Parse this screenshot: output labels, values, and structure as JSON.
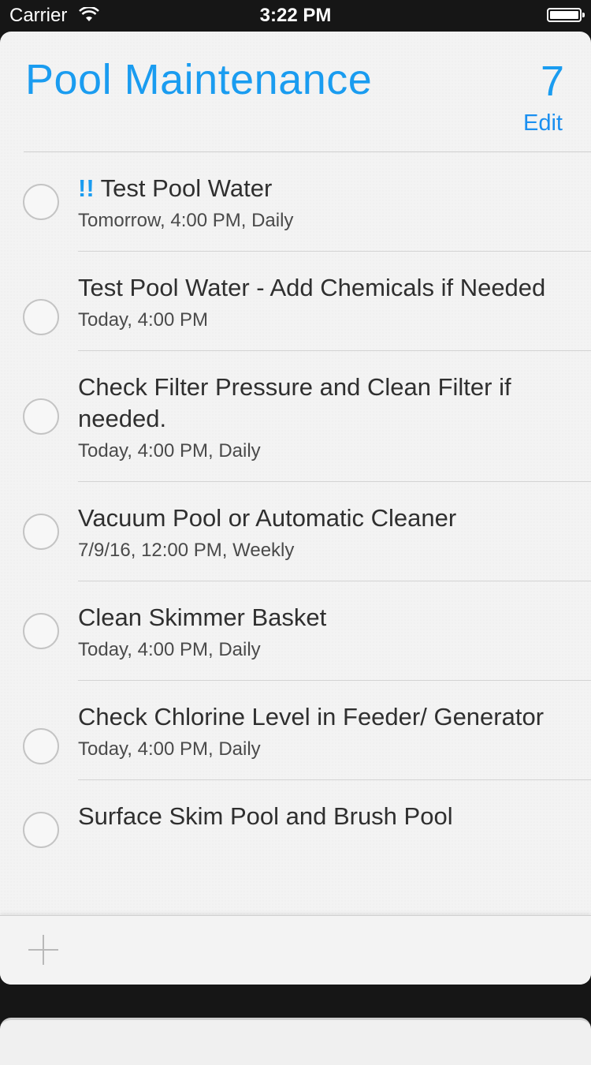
{
  "status_bar": {
    "carrier": "Carrier",
    "time": "3:22 PM",
    "wifi_icon": "wifi-icon",
    "battery_icon": "battery-icon"
  },
  "list": {
    "title": "Pool Maintenance",
    "count": "7",
    "edit_label": "Edit",
    "accent_color": "#1a9cf0"
  },
  "items": [
    {
      "priority": "!!",
      "title": "Test Pool Water",
      "subtitle": "Tomorrow, 4:00 PM, Daily"
    },
    {
      "priority": "",
      "title": "Test Pool Water - Add Chemicals if Needed",
      "subtitle": "Today, 4:00 PM"
    },
    {
      "priority": "",
      "title": "Check Filter Pressure and Clean Filter if needed.",
      "subtitle": "Today, 4:00 PM, Daily"
    },
    {
      "priority": "",
      "title": "Vacuum Pool or Automatic Cleaner",
      "subtitle": "7/9/16, 12:00 PM, Weekly"
    },
    {
      "priority": "",
      "title": "Clean Skimmer Basket",
      "subtitle": "Today, 4:00 PM, Daily"
    },
    {
      "priority": "",
      "title": "Check Chlorine Level in Feeder/ Generator",
      "subtitle": "Today, 4:00 PM, Daily"
    },
    {
      "priority": "",
      "title": "Surface Skim Pool and Brush Pool",
      "subtitle": ""
    }
  ],
  "footer": {
    "add_icon": "plus-icon"
  }
}
